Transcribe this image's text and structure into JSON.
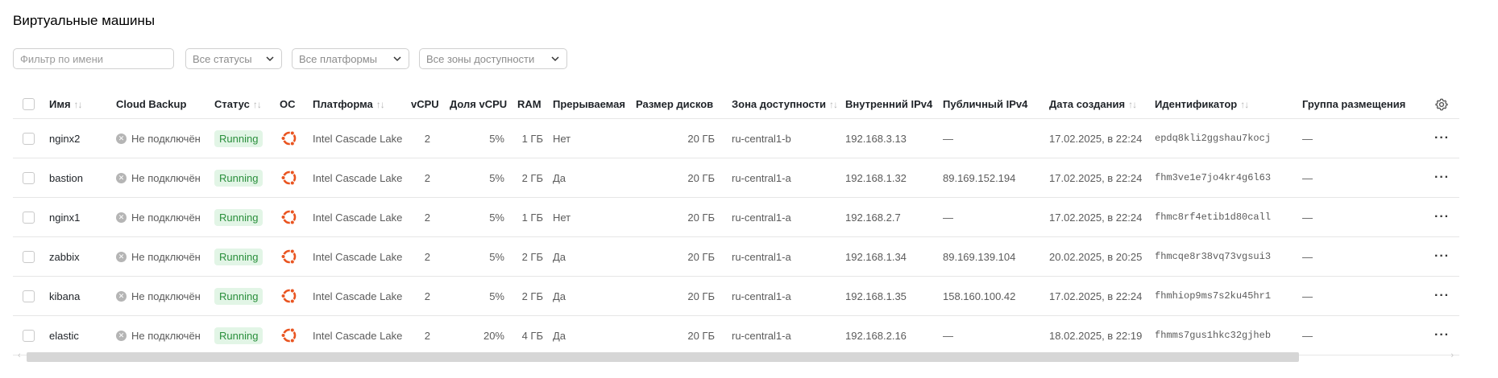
{
  "page": {
    "title": "Виртуальные машины"
  },
  "filters": {
    "name_placeholder": "Фильтр по имени",
    "status": "Все статусы",
    "platform": "Все платформы",
    "zone": "Все зоны доступности"
  },
  "columns": {
    "name": "Имя",
    "backup": "Cloud Backup",
    "status": "Статус",
    "os": "ОС",
    "platform": "Платформа",
    "vcpu": "vCPU",
    "vcpu_share": "Доля vCPU",
    "ram": "RAM",
    "preemptible": "Прерываемая",
    "disk_size": "Размер дисков",
    "zone": "Зона доступности",
    "ipv4_internal": "Внутренний IPv4",
    "ipv4_public": "Публичный IPv4",
    "created": "Дата создания",
    "id": "Идентификатор",
    "placement": "Группа размещения"
  },
  "rows": [
    {
      "name": "nginx2",
      "backup": "Не подключён",
      "status": "Running",
      "os_icon": "ubuntu-icon",
      "platform": "Intel Cascade Lake",
      "vcpu": "2",
      "vcpu_share": "5%",
      "ram": "1 ГБ",
      "preemptible": "Нет",
      "disk": "20 ГБ",
      "zone": "ru-central1-b",
      "ip_int": "192.168.3.13",
      "ip_pub": "—",
      "created": "17.02.2025, в 22:24",
      "id": "epdq8kli2ggshau7kocj",
      "placement": "—"
    },
    {
      "name": "bastion",
      "backup": "Не подключён",
      "status": "Running",
      "os_icon": "ubuntu-icon",
      "platform": "Intel Cascade Lake",
      "vcpu": "2",
      "vcpu_share": "5%",
      "ram": "2 ГБ",
      "preemptible": "Да",
      "disk": "20 ГБ",
      "zone": "ru-central1-a",
      "ip_int": "192.168.1.32",
      "ip_pub": "89.169.152.194",
      "created": "17.02.2025, в 22:24",
      "id": "fhm3ve1e7jo4kr4g6l63",
      "placement": "—"
    },
    {
      "name": "nginx1",
      "backup": "Не подключён",
      "status": "Running",
      "os_icon": "ubuntu-icon",
      "platform": "Intel Cascade Lake",
      "vcpu": "2",
      "vcpu_share": "5%",
      "ram": "1 ГБ",
      "preemptible": "Нет",
      "disk": "20 ГБ",
      "zone": "ru-central1-a",
      "ip_int": "192.168.2.7",
      "ip_pub": "—",
      "created": "17.02.2025, в 22:24",
      "id": "fhmc8rf4etib1d80call",
      "placement": "—"
    },
    {
      "name": "zabbix",
      "backup": "Не подключён",
      "status": "Running",
      "os_icon": "ubuntu-icon",
      "platform": "Intel Cascade Lake",
      "vcpu": "2",
      "vcpu_share": "5%",
      "ram": "2 ГБ",
      "preemptible": "Да",
      "disk": "20 ГБ",
      "zone": "ru-central1-a",
      "ip_int": "192.168.1.34",
      "ip_pub": "89.169.139.104",
      "created": "20.02.2025, в 20:25",
      "id": "fhmcqe8r38vq73vgsui3",
      "placement": "—"
    },
    {
      "name": "kibana",
      "backup": "Не подключён",
      "status": "Running",
      "os_icon": "ubuntu-icon",
      "platform": "Intel Cascade Lake",
      "vcpu": "2",
      "vcpu_share": "5%",
      "ram": "2 ГБ",
      "preemptible": "Да",
      "disk": "20 ГБ",
      "zone": "ru-central1-a",
      "ip_int": "192.168.1.35",
      "ip_pub": "158.160.100.42",
      "created": "17.02.2025, в 22:24",
      "id": "fhmhiop9ms7s2ku45hr1",
      "placement": "—"
    },
    {
      "name": "elastic",
      "backup": "Не подключён",
      "status": "Running",
      "os_icon": "ubuntu-icon",
      "platform": "Intel Cascade Lake",
      "vcpu": "2",
      "vcpu_share": "20%",
      "ram": "4 ГБ",
      "preemptible": "Да",
      "disk": "20 ГБ",
      "zone": "ru-central1-a",
      "ip_int": "192.168.2.16",
      "ip_pub": "—",
      "created": "18.02.2025, в 22:19",
      "id": "fhmms7gus1hkc32gjheb",
      "placement": "—"
    }
  ],
  "colors": {
    "status_bg": "#e2f5e6",
    "status_fg": "#2a8f3c",
    "ubuntu_orange": "#e95420"
  }
}
